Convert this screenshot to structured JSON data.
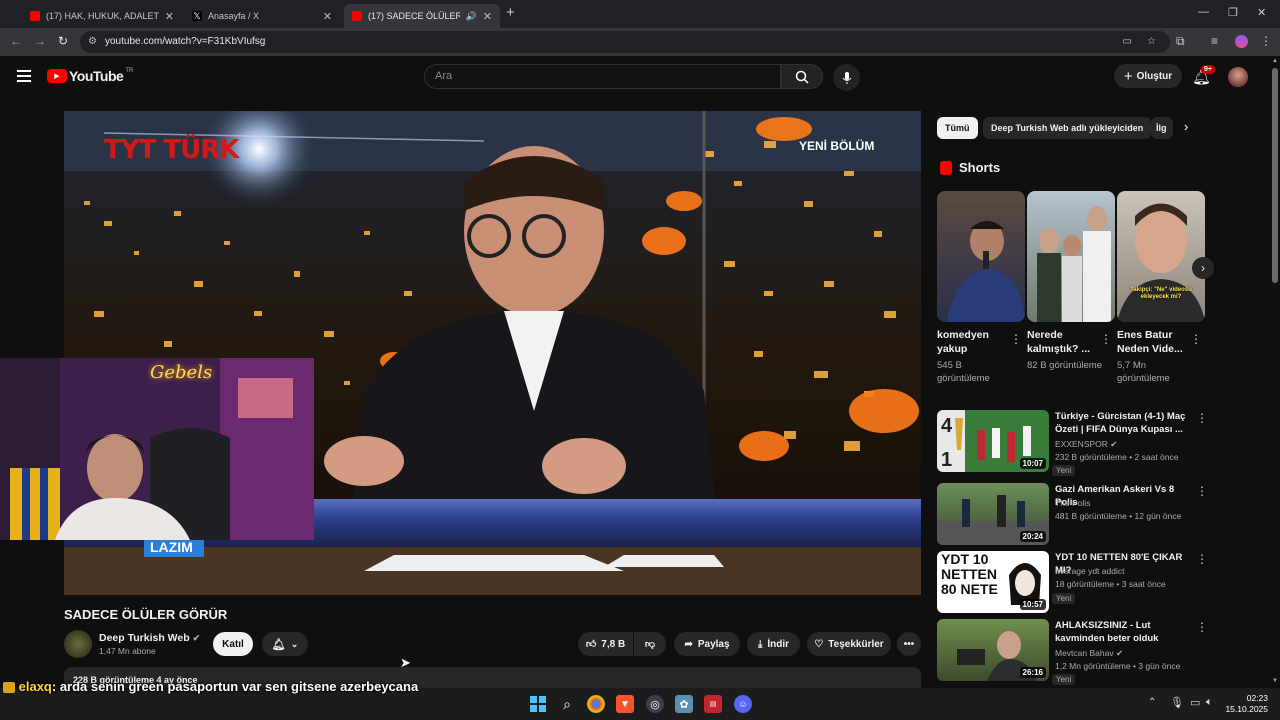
{
  "tabs": [
    {
      "title": "(17) HAK, HUKUK, ADALET | Ma",
      "active": false
    },
    {
      "title": "Anasayfa / X",
      "active": false
    },
    {
      "title": "(17) SADECE ÖLÜLER GÖRÜ",
      "active": true
    }
  ],
  "new_tab": "+",
  "url": "youtube.com/watch?v=F31KbVIufsg",
  "youtube": {
    "logo": "YouTube",
    "logo_sup": "TR",
    "search_placeholder": "Ara",
    "create_label": "Oluştur",
    "notif_count": "9+"
  },
  "video": {
    "channel_logo": "TYT TÜRK",
    "overlay_label": "YENİ BÖLÜM",
    "lower_text": "LAZIM",
    "neon_sign": "Gebels"
  },
  "chips": [
    "Tümü",
    "Deep Turkish Web adlı yükleyiciden",
    "İlg"
  ],
  "shorts": {
    "heading": "Shorts",
    "items": [
      {
        "title": "komedyen yakup",
        "views": "545 B görüntüleme"
      },
      {
        "title": "Nerede kalmıştık? ...",
        "views": "82 B görüntüleme"
      },
      {
        "title": "Enes Batur Neden Vide...",
        "views": "5,7 Mn görüntüleme"
      }
    ],
    "third_caption": "Takipçi: \"Ne\" videosu ekleyecek mi?"
  },
  "recommendations": [
    {
      "title": "Türkiye - Gürcistan (4-1) Maç Özeti | FIFA Dünya Kupası ...",
      "channel": "EXXENSPOR",
      "verified": true,
      "meta": "232 B görüntüleme • 2 saat önce",
      "duration": "10:07",
      "badge": "Yeni"
    },
    {
      "title": "Gazi Amerikan Askeri Vs 8 Polis",
      "channel": "The Polis",
      "verified": false,
      "meta": "481 B görüntüleme • 12 gün önce",
      "duration": "20:24",
      "badge": ""
    },
    {
      "title": "YDT 10 NETTEN 80'E ÇIKAR MI?",
      "channel": "average ydt addict",
      "verified": false,
      "meta": "18 görüntüleme • 3 saat önce",
      "duration": "10:57",
      "badge": "Yeni",
      "thumb_text": "YDT 10 NETTEN 80 NETE"
    },
    {
      "title": "AHLAKSIZSINIZ - Lut kavminden beter olduk",
      "channel": "Mevtcan Bahav",
      "verified": true,
      "meta": "1,2 Mn görüntüleme • 3 gün önce",
      "duration": "26:16",
      "badge": "Yeni"
    }
  ],
  "watch": {
    "title": "SADECE ÖLÜLER GÖRÜR",
    "channel": "Deep Turkish Web",
    "subscribers": "1,47 Mn abone",
    "join_label": "Katıl",
    "likes": "7,8 B",
    "share_label": "Paylaş",
    "download_label": "İndir",
    "thanks_label": "Teşekkürler",
    "more_label": "•••",
    "description_meta": "228 B görüntüleme  4 ay önce"
  },
  "chat": {
    "user": "elaxq",
    "message": ": arda senin green pasaportun var sen gitsene azerbeycana"
  },
  "taskbar": {
    "time": "02:23",
    "date": "15.10.2025"
  },
  "colors": {
    "accent_red": "#ff0000",
    "bg": "#0f0f0f",
    "chip_bg": "#272727"
  }
}
